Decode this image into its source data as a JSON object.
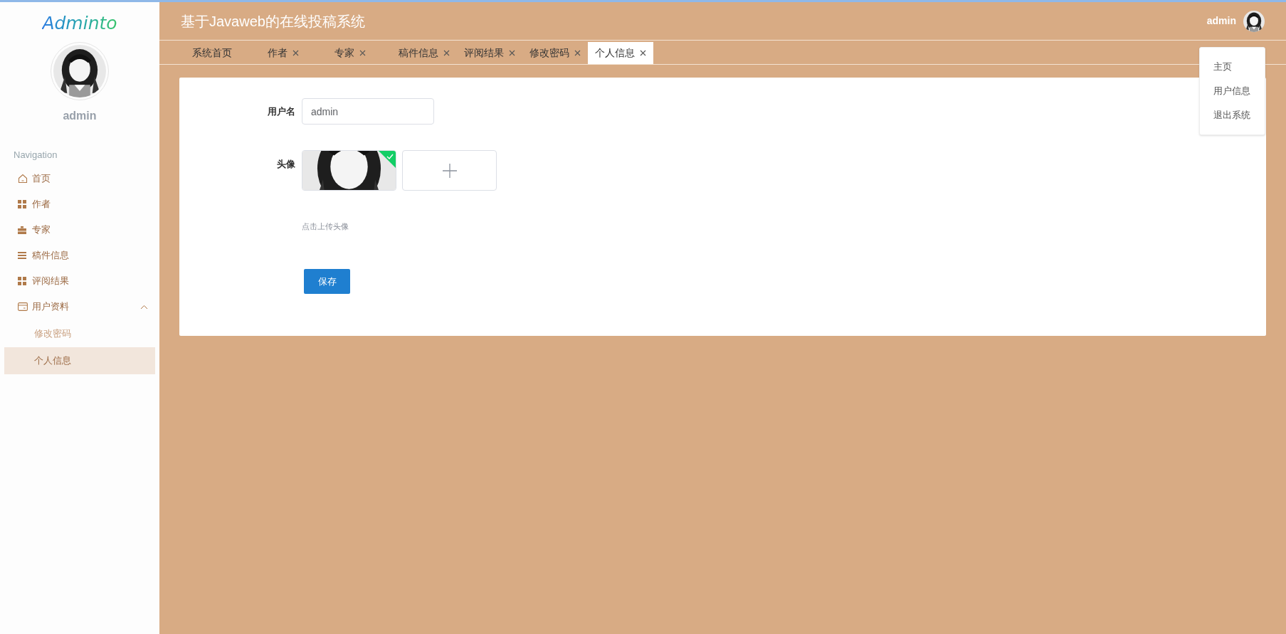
{
  "sidebar": {
    "logo": "Adminto",
    "user_name": "admin",
    "section_title": "Navigation",
    "items": [
      {
        "label": "首页",
        "selected": false
      },
      {
        "label": "作者",
        "selected": false
      },
      {
        "label": "专家",
        "selected": false
      },
      {
        "label": "稿件信息",
        "selected": false
      },
      {
        "label": "评阅结果",
        "selected": false
      },
      {
        "label": "用户资料",
        "selected": false,
        "expanded": true,
        "children": [
          {
            "label": "修改密码",
            "selected": false
          },
          {
            "label": "个人信息",
            "selected": true
          }
        ]
      }
    ]
  },
  "header": {
    "title": "基于Javaweb的在线投稿系统",
    "user_name": "admin"
  },
  "tabs": [
    {
      "label": "系统首页",
      "closable": false,
      "selected": false
    },
    {
      "label": "作者",
      "closable": true,
      "selected": false
    },
    {
      "label": "专家",
      "closable": true,
      "selected": false
    },
    {
      "label": "稿件信息",
      "closable": true,
      "selected": false
    },
    {
      "label": "评阅结果",
      "closable": true,
      "selected": false
    },
    {
      "label": "修改密码",
      "closable": true,
      "selected": false
    },
    {
      "label": "个人信息",
      "closable": true,
      "selected": true
    }
  ],
  "user_menu": {
    "open": true,
    "items": [
      "主页",
      "用户信息",
      "退出系统"
    ]
  },
  "form": {
    "username_label": "用户名",
    "username_value": "admin",
    "avatar_label": "头像",
    "upload_hint": "点击上传头像",
    "upload_done": true,
    "save_button": "保存"
  }
}
